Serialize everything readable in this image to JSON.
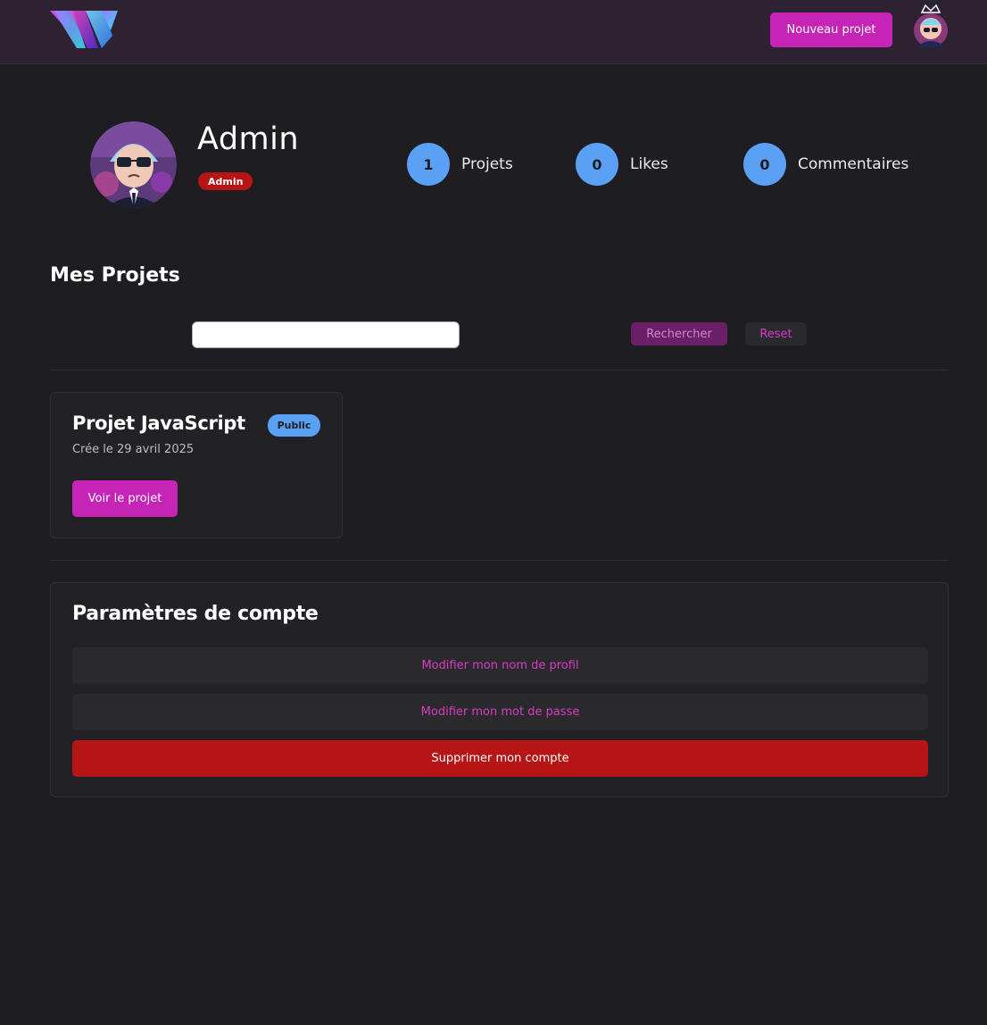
{
  "navbar": {
    "new_project_label": "Nouveau projet"
  },
  "profile": {
    "name": "Admin",
    "role": "Admin",
    "stats": [
      {
        "value": "1",
        "label": "Projets"
      },
      {
        "value": "0",
        "label": "Likes"
      },
      {
        "value": "0",
        "label": "Commentaires"
      }
    ]
  },
  "projects_section": {
    "title": "Mes Projets",
    "search_value": "",
    "search_button": "Rechercher",
    "reset_button": "Reset",
    "projects": [
      {
        "title": "Projet JavaScript",
        "visibility": "Public",
        "date": "Crée le 29 avril 2025",
        "view_label": "Voir le projet"
      }
    ]
  },
  "settings": {
    "title": "Paramètres de compte",
    "edit_name_label": "Modifier mon nom de profil",
    "edit_password_label": "Modifier mon mot de passe",
    "delete_account_label": "Supprimer mon compte"
  },
  "colors": {
    "accent": "#c624b7",
    "stat_circle": "#5aa0f5",
    "danger": "#b71515",
    "background": "#1d1d22"
  }
}
